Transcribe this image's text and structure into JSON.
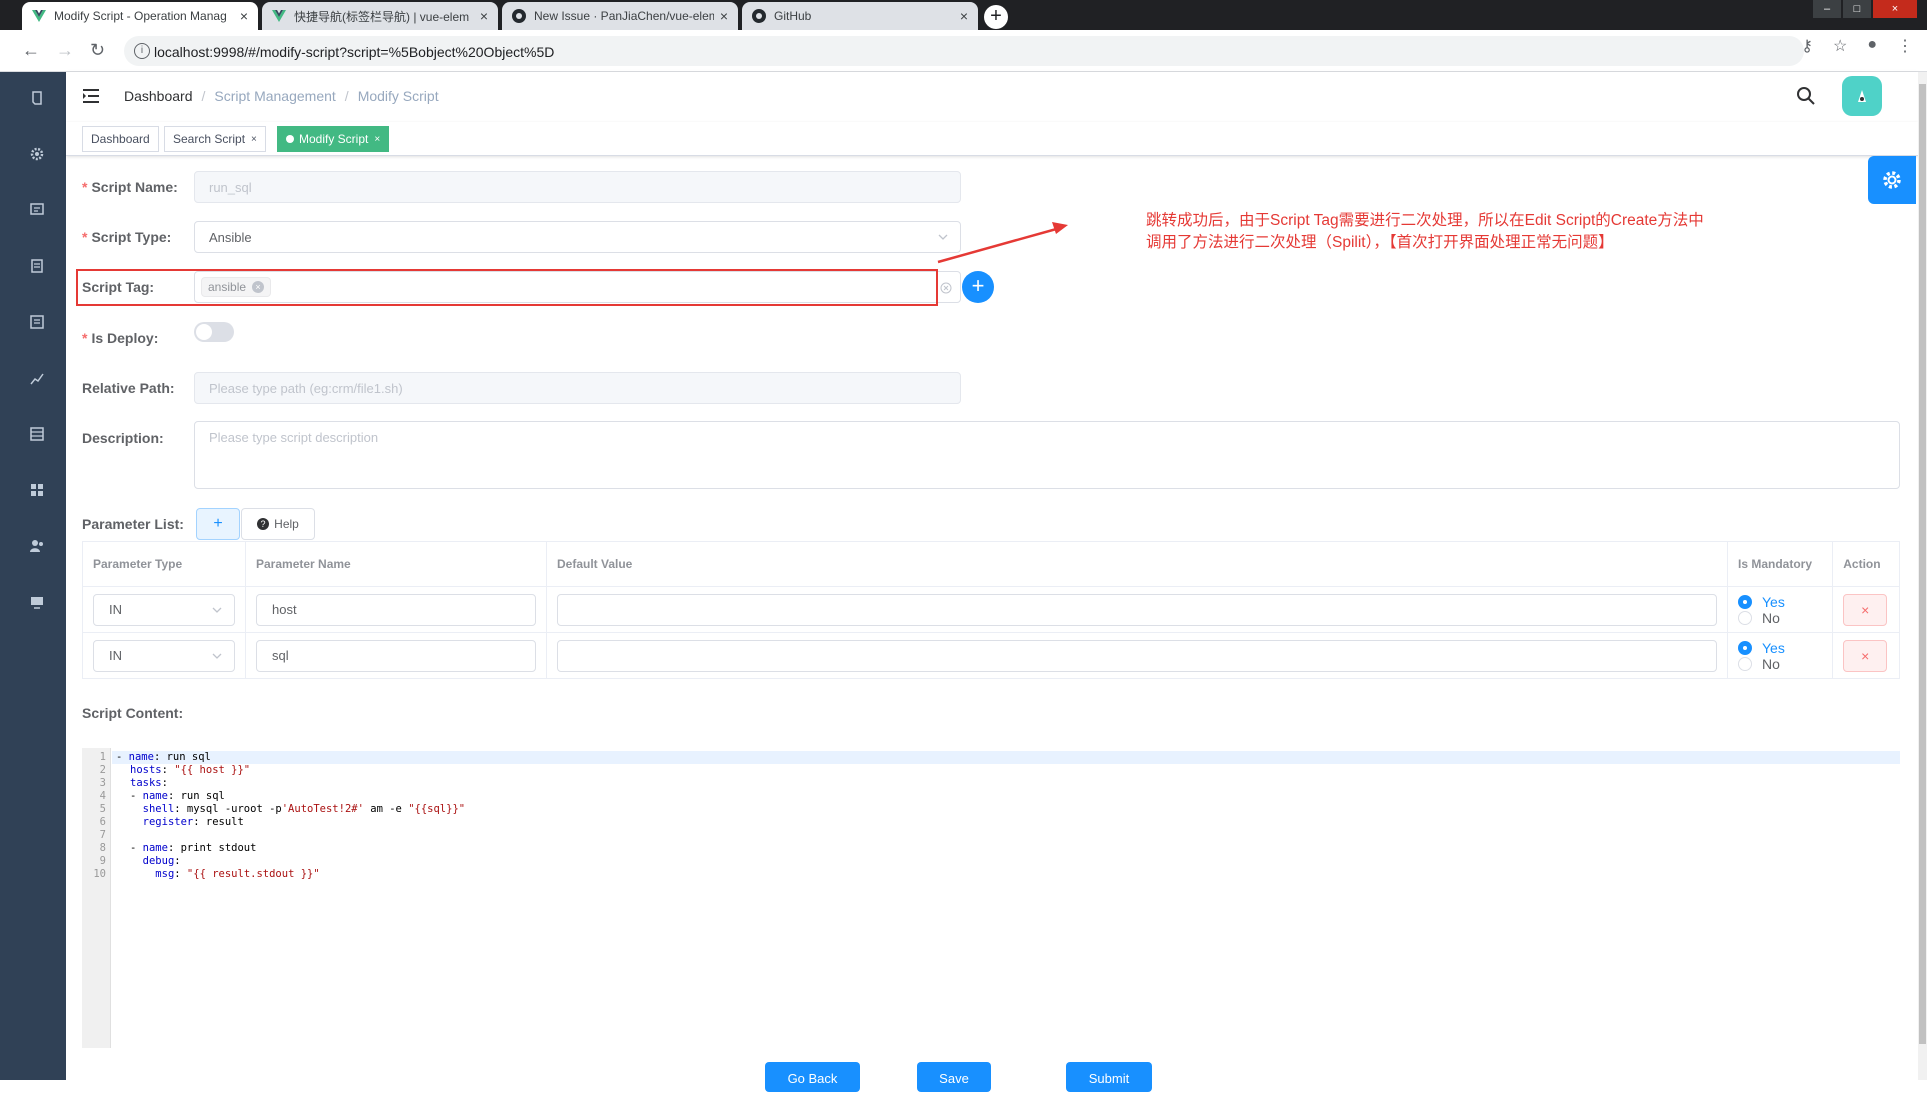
{
  "browser": {
    "tabs": [
      {
        "title": "Modify Script - Operation Manag",
        "active": true
      },
      {
        "title": "快捷导航(标签栏导航) | vue-elem",
        "active": false
      },
      {
        "title": "New Issue · PanJiaChen/vue-elem",
        "active": false
      },
      {
        "title": "GitHub",
        "active": false
      }
    ],
    "new_tab": "+",
    "url": "localhost:9998/#/modify-script?script=%5Bobject%20Object%5D"
  },
  "sidebar": {
    "icons": [
      "documentation-icon",
      "settings-icon",
      "form-icon",
      "list-icon",
      "edit-icon",
      "chart-icon",
      "table-icon",
      "component-icon",
      "peoples-icon",
      "monitor-icon"
    ]
  },
  "navbar": {
    "breadcrumb": [
      "Dashboard",
      "Script Management",
      "Modify Script"
    ],
    "separator": "/"
  },
  "tagsview": {
    "tags": [
      {
        "label": "Dashboard",
        "active": false,
        "closable": false
      },
      {
        "label": "Search Script",
        "active": false,
        "closable": true
      },
      {
        "label": "Modify Script",
        "active": true,
        "closable": true
      }
    ],
    "close_glyph": "×"
  },
  "form": {
    "script_name": {
      "label": "Script Name:",
      "required": true,
      "value": "run_sql"
    },
    "script_type": {
      "label": "Script Type:",
      "required": true,
      "value": "Ansible"
    },
    "script_tag": {
      "label": "Script Tag:",
      "tags": [
        "ansible"
      ],
      "add": "+"
    },
    "is_deploy": {
      "label": "Is Deploy:",
      "required": true,
      "value": false
    },
    "relative_path": {
      "label": "Relative Path:",
      "placeholder": "Please type path (eg:crm/file1.sh)"
    },
    "description": {
      "label": "Description:",
      "placeholder": "Please type script description"
    },
    "parameter_list": {
      "label": "Parameter List:",
      "add": "+",
      "help": "Help"
    }
  },
  "params_table": {
    "headers": [
      "Parameter Type",
      "Parameter Name",
      "Default Value",
      "Is Mandatory",
      "Action"
    ],
    "rows": [
      {
        "type": "IN",
        "name": "host",
        "default": "",
        "mandatory": "Yes"
      },
      {
        "type": "IN",
        "name": "sql",
        "default": "",
        "mandatory": "Yes"
      }
    ],
    "yes_label": "Yes",
    "no_label": "No",
    "delete_glyph": "×"
  },
  "script_content": {
    "label": "Script Content:",
    "line_numbers": [
      "1",
      "2",
      "3",
      "4",
      "5",
      "6",
      "7",
      "8",
      "9",
      "10"
    ]
  },
  "buttons": {
    "go_back": "Go Back",
    "save": "Save",
    "submit": "Submit"
  },
  "annotation": {
    "line1": "跳转成功后，由于Script Tag需要进行二次处理，所以在Edit Script的Create方法中",
    "line2": "调用了方法进行二次处理（Spilit），【首次打开界面处理正常无问题】"
  },
  "colors": {
    "primary": "#1890ff",
    "active_tag": "#42b983",
    "sidebar": "#304156",
    "annotation": "#e53935",
    "danger": "#f56c6c"
  }
}
